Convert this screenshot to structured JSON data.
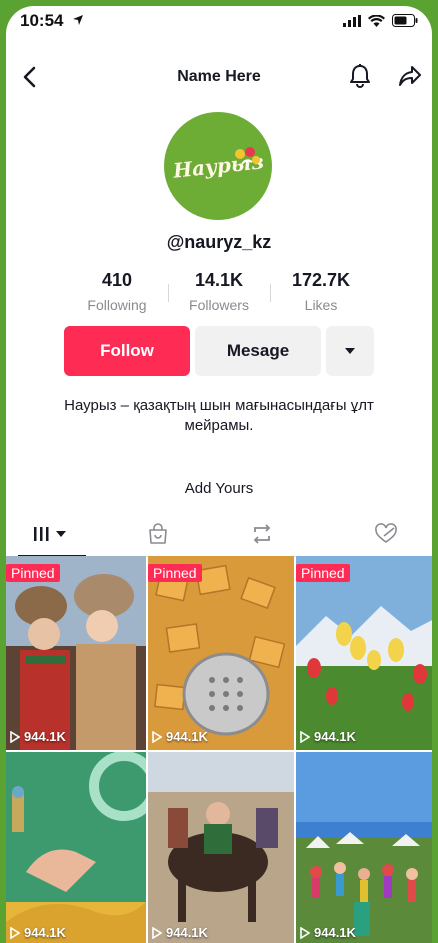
{
  "status_bar": {
    "time": "10:54"
  },
  "header": {
    "title": "Name Here"
  },
  "profile": {
    "avatar_text": "Наурыз",
    "username": "@nauryz_kz",
    "stats": [
      {
        "value": "410",
        "label": "Following"
      },
      {
        "value": "14.1K",
        "label": "Followers"
      },
      {
        "value": "172.7K",
        "label": "Likes"
      }
    ],
    "follow_label": "Follow",
    "message_label": "Mesage",
    "bio": "Наурыз – қазақтың шын мағынасындағы ұлт мейрамы.",
    "add_yours": "Add Yours"
  },
  "tabs": [
    {
      "icon": "grid-icon",
      "active": true
    },
    {
      "icon": "shop-bag-icon",
      "active": false
    },
    {
      "icon": "repost-icon",
      "active": false
    },
    {
      "icon": "liked-heart-icon",
      "active": false
    }
  ],
  "videos": [
    {
      "pinned": "Pinned",
      "views": "944.1K",
      "scene": "people"
    },
    {
      "pinned": "Pinned",
      "views": "944.1K",
      "scene": "food"
    },
    {
      "pinned": "Pinned",
      "views": "944.1K",
      "scene": "tulips"
    },
    {
      "pinned": "",
      "views": "944.1K",
      "scene": "hand"
    },
    {
      "pinned": "",
      "views": "944.1K",
      "scene": "horses"
    },
    {
      "pinned": "",
      "views": "944.1K",
      "scene": "crowd"
    }
  ],
  "colors": {
    "accent": "#fe2c55",
    "avatar_bg": "#6dac35",
    "frame": "#5aa332"
  }
}
